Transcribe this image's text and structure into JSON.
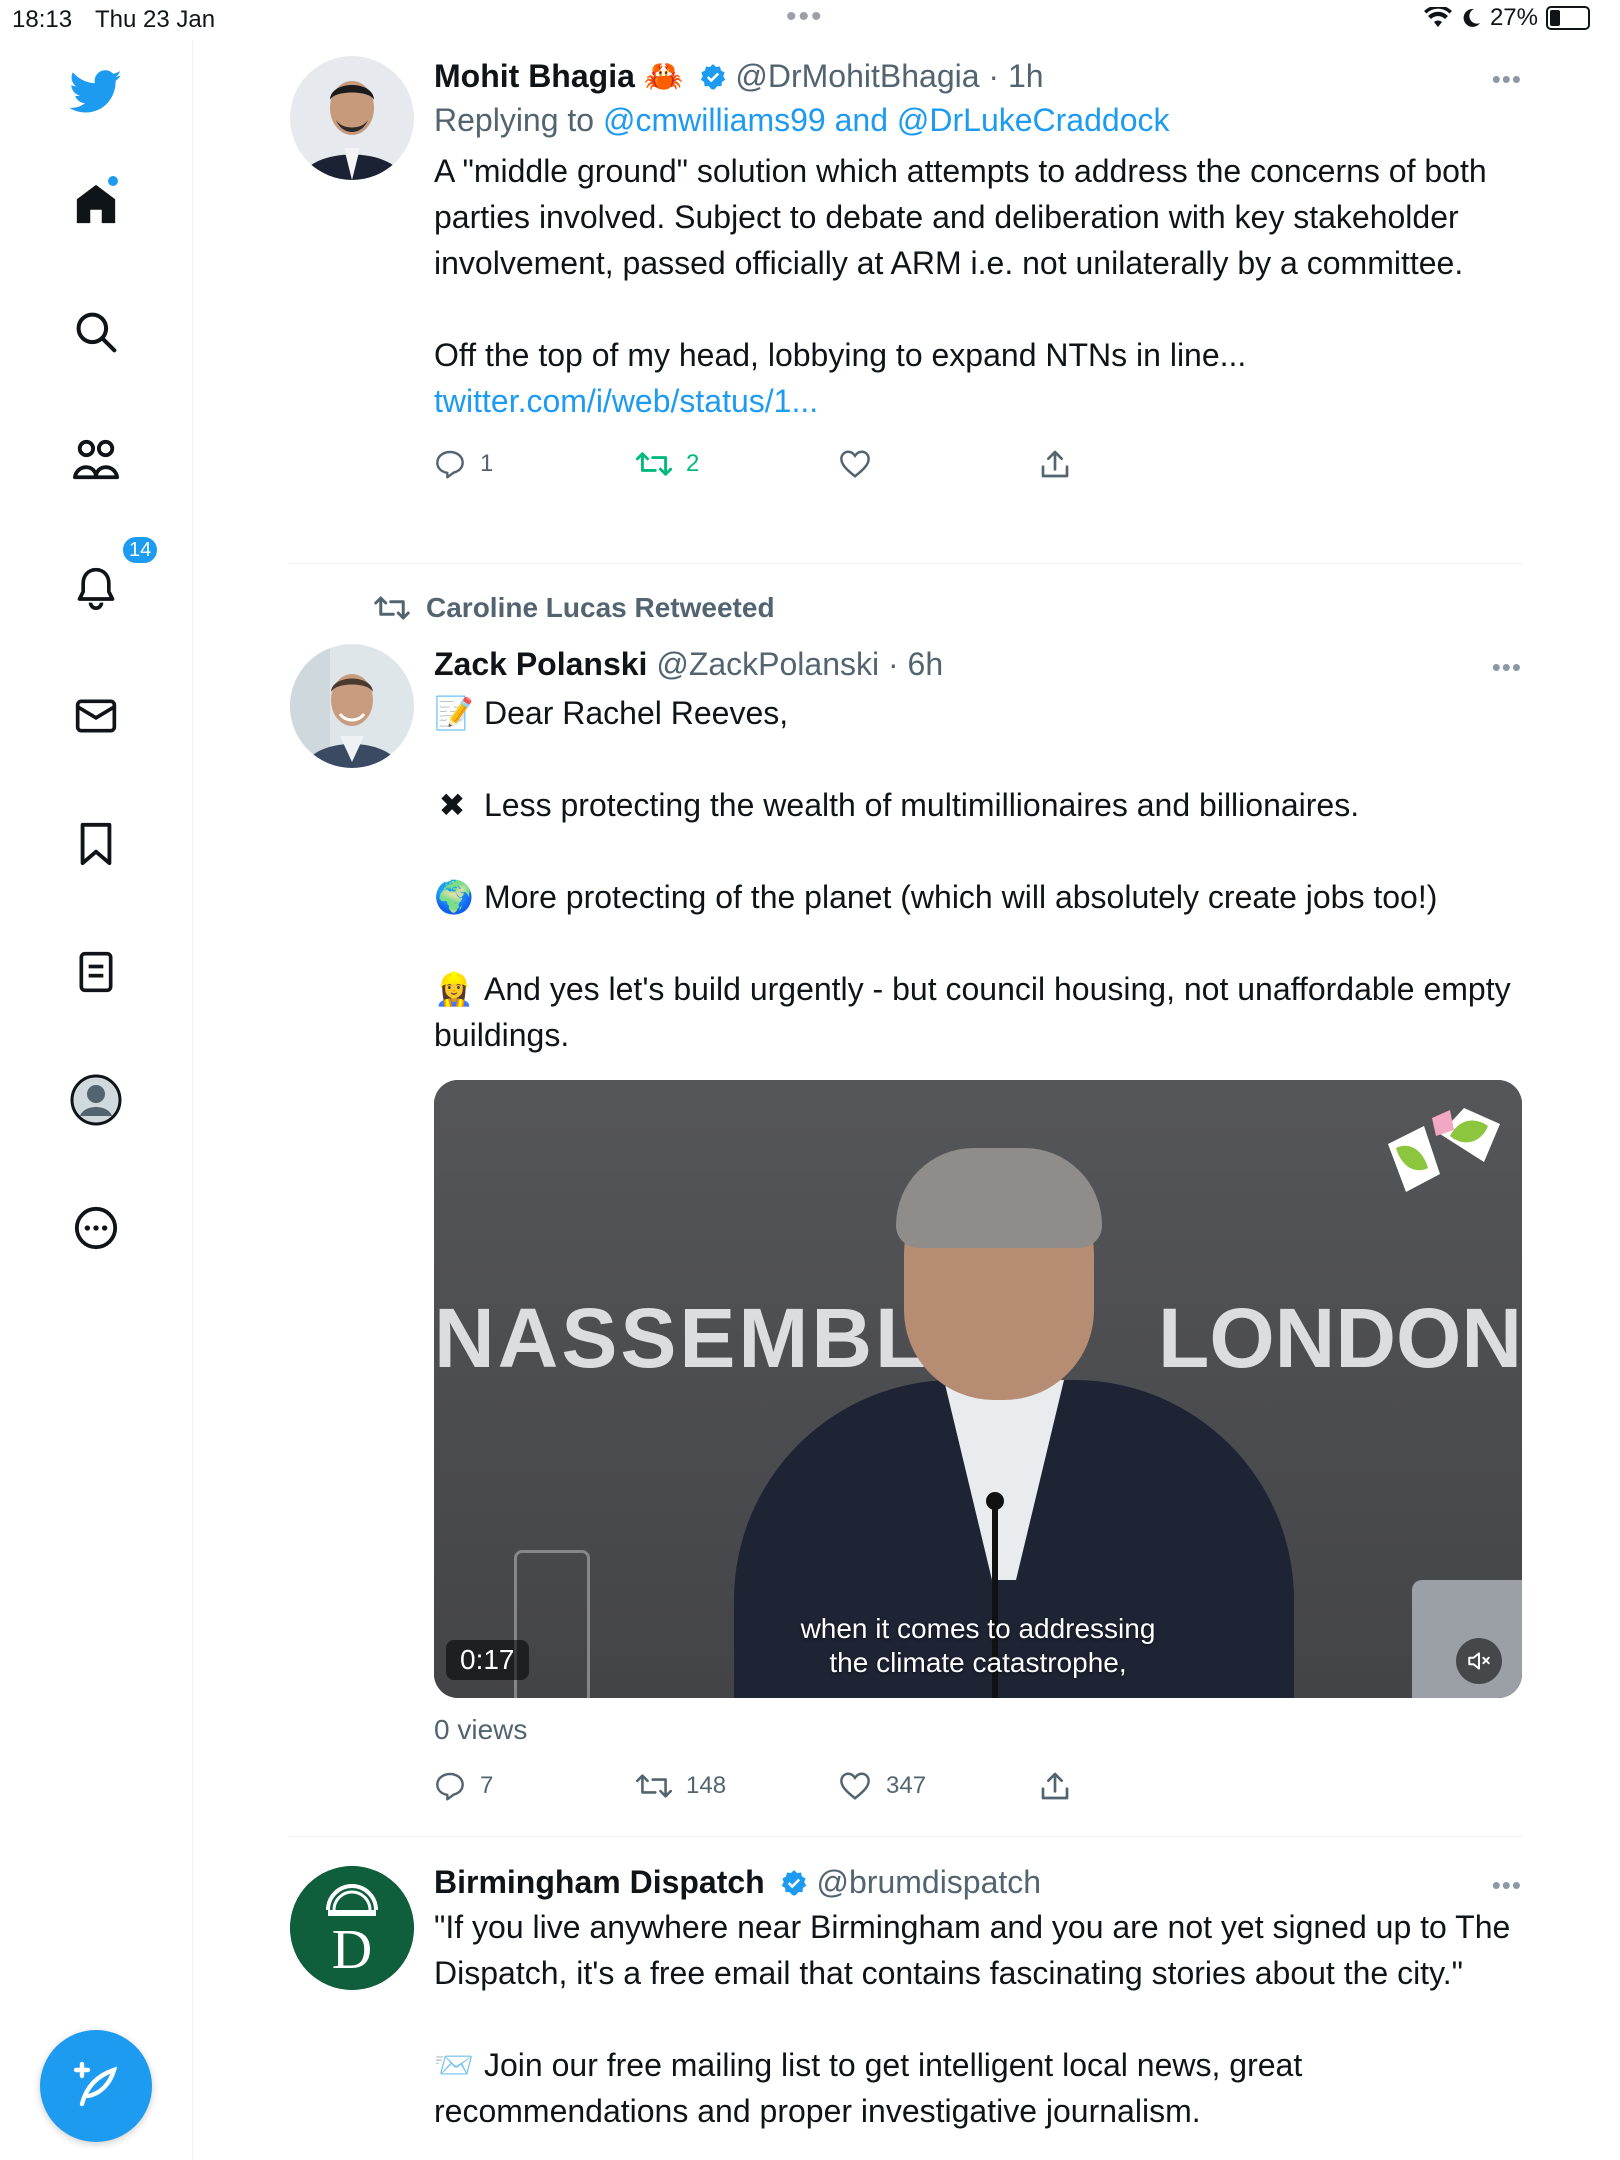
{
  "status_bar": {
    "time": "18:13",
    "date": "Thu 23 Jan",
    "battery": "27%",
    "battery_level": 0.27
  },
  "sidebar": {
    "notification_count": "14",
    "items": [
      "home",
      "search",
      "communities",
      "notifications",
      "messages",
      "bookmarks",
      "lists",
      "profile",
      "more"
    ]
  },
  "tweets": [
    {
      "name": "Mohit Bhagia",
      "name_emoji": "🦀",
      "handle": "@DrMohitBhagia",
      "time": "· 1h",
      "replying_prefix": "Replying to",
      "replying_to": "@cmwilliams99 and @DrLukeCraddock",
      "para1": "A \"middle ground\" solution which attempts to address the concerns of both parties involved. Subject to debate and deliberation with key stakeholder involvement, passed officially at ARM i.e. not unilaterally by a committee.",
      "para2": "Off the top of my head, lobbying to expand NTNs in line... ",
      "link": "twitter.com/i/web/status/1...",
      "replies": "1",
      "retweets": "2",
      "likes": ""
    },
    {
      "retweeted_by": "Caroline Lucas Retweeted",
      "name": "Zack Polanski",
      "handle": "@ZackPolanski",
      "time": "· 6h",
      "lines": [
        {
          "emoji": "📝",
          "text": "Dear Rachel Reeves,"
        },
        {
          "emoji": "✖",
          "text": "Less protecting the wealth of multimillionaires and billionaires."
        },
        {
          "emoji": "🌍",
          "text": "More protecting of the planet (which will absolutely create jobs too!)"
        },
        {
          "emoji": "👷‍♀️",
          "text": "And yes let's build urgently - but council housing, not unaffordable empty buildings."
        }
      ],
      "video": {
        "word_left": "NASSEMBLY",
        "word_right": "LONDON",
        "subtitle_1": "when it comes to addressing",
        "subtitle_2": "the climate catastrophe,",
        "duration": "0:17"
      },
      "views": "0 views",
      "replies": "7",
      "retweets": "148",
      "likes": "347"
    },
    {
      "name": "Birmingham Dispatch",
      "handle": "@brumdispatch",
      "avatar_letter": "D",
      "para1": "\"If you live anywhere near Birmingham and you are not yet signed up to The Dispatch, it's a free email that contains fascinating stories about the city.\"",
      "para2_emoji": "📨",
      "para2": "Join our free mailing list to get intelligent local news, great recommendations and proper investigative journalism."
    }
  ],
  "colors": {
    "accent": "#1d9bf0",
    "retweet_green": "#00ba7c",
    "text": "#0f1419",
    "secondary": "#536471",
    "dispatch_green": "#0f5e3c"
  }
}
